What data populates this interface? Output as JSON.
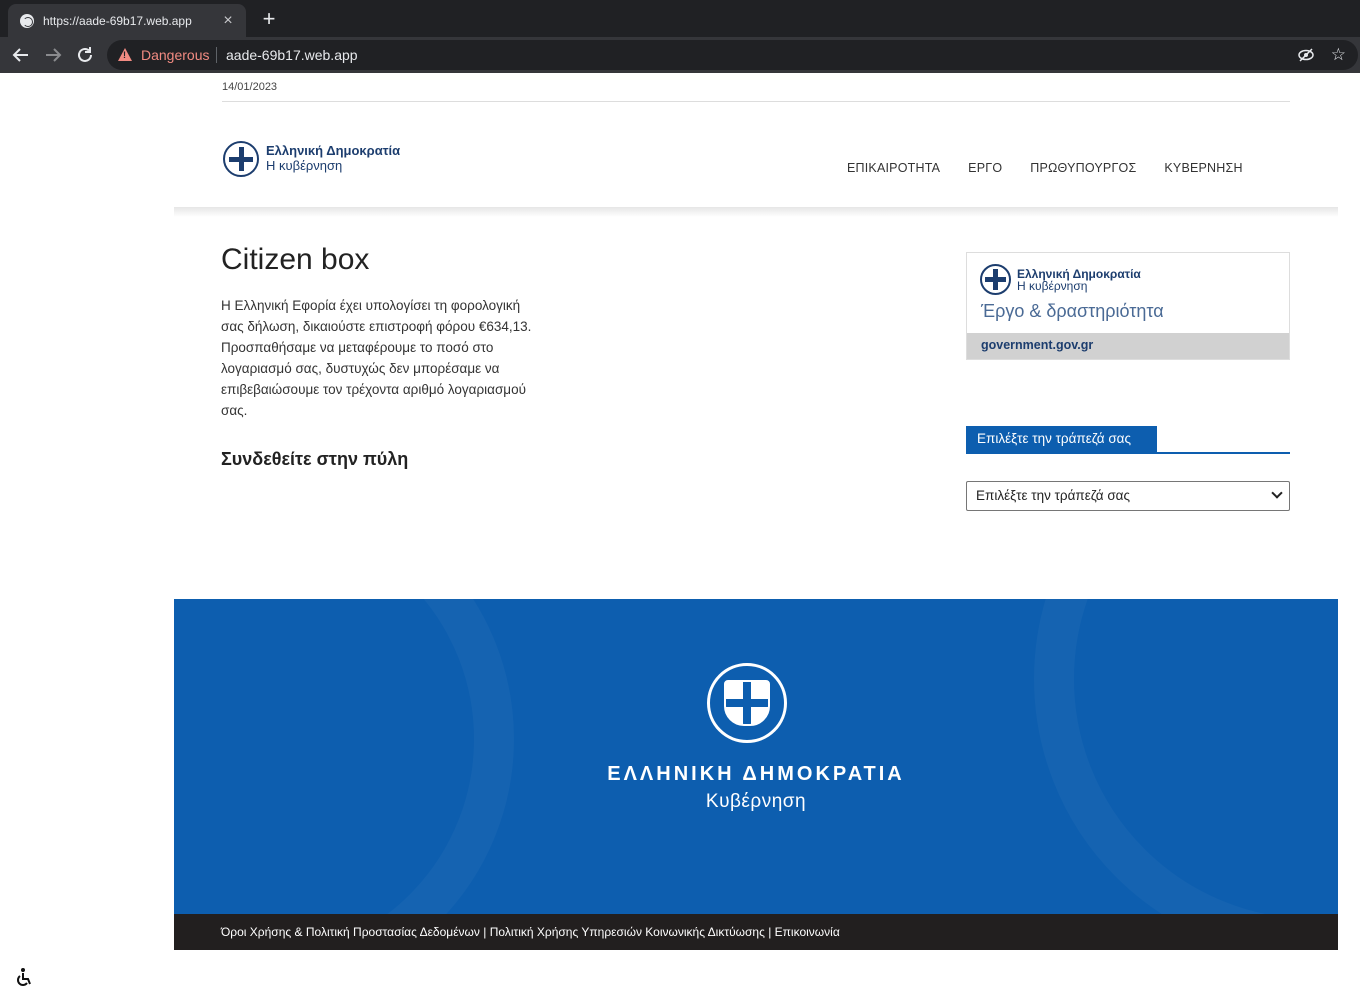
{
  "browser": {
    "tab_title": "https://aade-69b17.web.app",
    "close_tab": "×",
    "new_tab": "+",
    "security_label": "Dangerous",
    "url": "aade-69b17.web.app",
    "back_icon": "arrow-left-icon",
    "forward_icon": "arrow-right-icon",
    "reload_icon": "reload-icon",
    "star_icon": "star-icon",
    "warning_color": "#f28b82"
  },
  "topbar": {
    "date": "14/01/2023"
  },
  "header": {
    "logo_title": "Ελληνική Δημοκρατία",
    "logo_subtitle": "Η κυβέρνηση",
    "nav": [
      "ΕΠΙΚΑΙΡΟΤΗΤΑ",
      "ΕΡΓΟ",
      "ΠΡΩΘΥΠΟΥΡΓΟΣ",
      "ΚΥΒΕΡΝΗΣΗ"
    ]
  },
  "main": {
    "title": "Citizen box",
    "intro": "Η Ελληνική Εφορία έχει υπολογίσει τη φορολογική σας δήλωση, δικαιούστε επιστροφή φόρου €634,13. Προσπαθήσαμε να μεταφέρουμε το ποσό στο λογαριασμό σας, δυστυχώς δεν μπορέσαμε να επιβεβαιώσουμε τον τρέχοντα αριθμό λογαριασμού σας.",
    "login_heading": "Συνδεθείτε στην πύλη"
  },
  "sidebar": {
    "card_logo_title": "Ελληνική Δημοκρατία",
    "card_logo_subtitle": "Η κυβέρνηση",
    "card_tagline": "Έργο & δραστηριότητα",
    "card_link": "government.gov.gr",
    "bank_tab": "Επιλέξτε την τράπεζά σας",
    "bank_select_value": "Επιλέξτε την τράπεζά σας",
    "accent_color": "#0d5eaf"
  },
  "footer": {
    "title": "ΕΛΛΗΝΙΚΗ ΔΗΜΟΚΡΑΤΙΑ",
    "subtitle": "Κυβέρνηση",
    "links": "Όροι Χρήσης & Πολιτική Προστασίας Δεδομένων | Πολιτική Χρήσης Υπηρεσιών Κοινωνικής Δικτύωσης | Επικοινωνία",
    "band_color": "#0d5eaf",
    "bar_color": "#221f1f"
  },
  "accessibility": {
    "icon": "accessibility-icon"
  }
}
